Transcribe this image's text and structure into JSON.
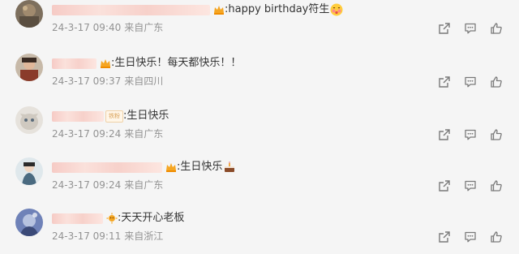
{
  "comments": [
    {
      "text": ":happy birthday符生",
      "time": "24-3-17 09:40",
      "location": "来自广东",
      "badge": "crown-badge-icon",
      "emoji": "blushing-face-emoji"
    },
    {
      "text": ":生日快乐！每天都快乐！！",
      "time": "24-3-17 09:37",
      "location": "来自四川",
      "badge": "crown-badge-icon",
      "emoji": ""
    },
    {
      "text": ":生日快乐",
      "time": "24-3-17 09:24",
      "location": "来自广东",
      "fan_tag": "铁粉",
      "emoji": ""
    },
    {
      "text": ":生日快乐",
      "time": "24-3-17 09:24",
      "location": "来自广东",
      "badge": "crown-badge-icon",
      "emoji": "cake-emoji"
    },
    {
      "text": ":天天开心老板",
      "time": "24-3-17 09:11",
      "location": "来自浙江",
      "badge": "sun-badge-icon",
      "emoji": ""
    }
  ],
  "icons": {
    "share": "share-icon",
    "comment": "comment-icon",
    "like": "like-icon"
  },
  "colors": {
    "background": "#f5f5f5",
    "text": "#333333",
    "meta": "#939393",
    "icon": "#7a7a7a",
    "name_mask": "#f6c9c3"
  }
}
